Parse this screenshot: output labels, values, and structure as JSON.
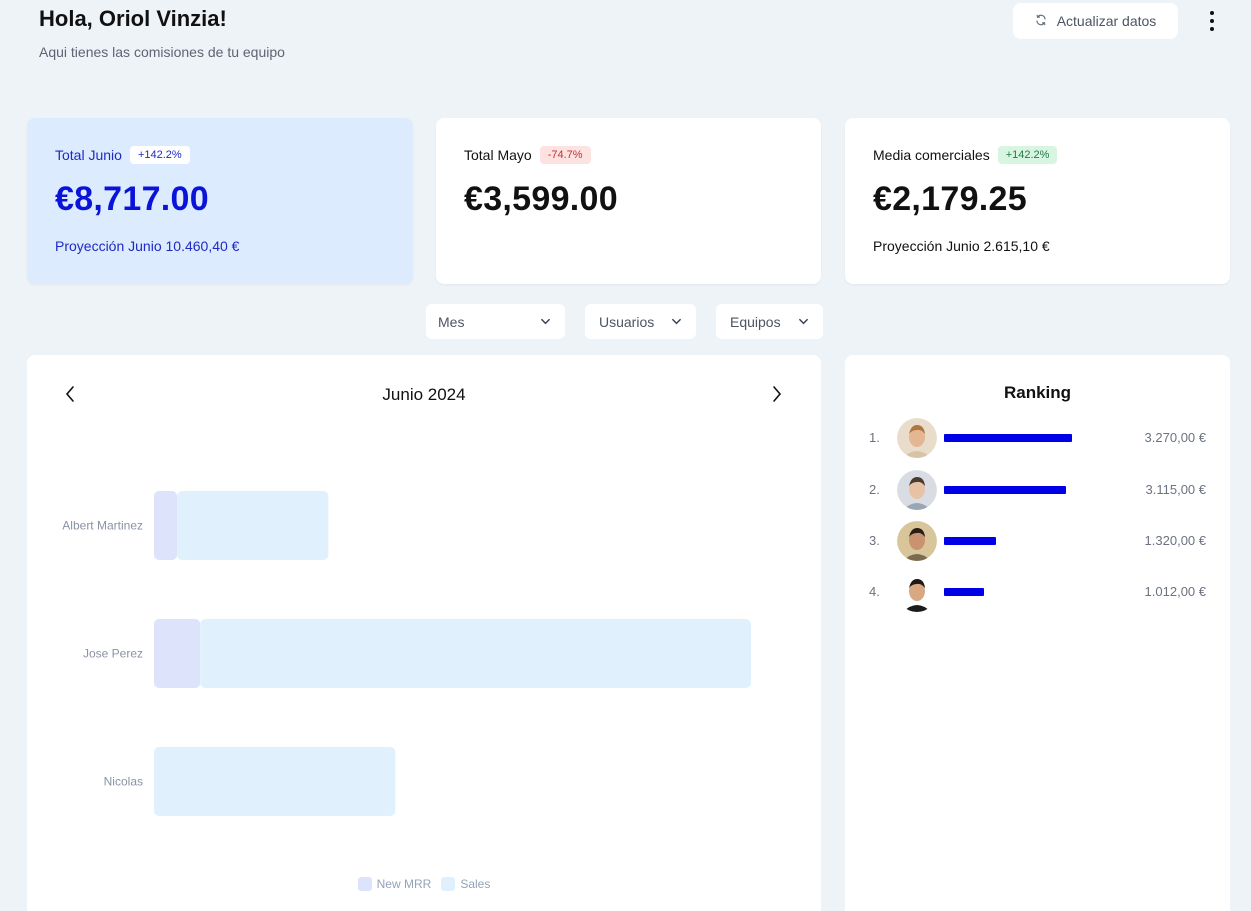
{
  "header": {
    "greeting": "Hola, Oriol Vinzia!",
    "subtitle": "Aqui tienes las comisiones de tu equipo",
    "refresh_label": "Actualizar datos"
  },
  "kpis": [
    {
      "label": "Total Junio",
      "badge": "+142.2%",
      "value": "€8,717.00",
      "projection": "Proyección Junio 10.460,40 €",
      "accent": "#0a14d8"
    },
    {
      "label": "Total Mayo",
      "badge": "-74.7%",
      "value": "€3,599.00",
      "projection": ""
    },
    {
      "label": "Media comerciales",
      "badge": "+142.2%",
      "value": "€2,179.25",
      "projection": "Proyección Junio 2.615,10 €"
    }
  ],
  "filters": {
    "period": "Mes",
    "users": "Usuarios",
    "teams": "Equipos"
  },
  "chart": {
    "month_label": "Junio 2024"
  },
  "chart_data": {
    "type": "bar",
    "orientation": "horizontal",
    "stacked": true,
    "categories": [
      "Albert Martinez",
      "Jose Perez",
      "Nicolas"
    ],
    "series": [
      {
        "name": "New MRR",
        "values": [
          200,
          400,
          0
        ],
        "color": "#dde3fb"
      },
      {
        "name": "Sales",
        "values": [
          1310,
          4770,
          2090
        ],
        "color": "#e0f1fd"
      }
    ],
    "legend": "bottom-center",
    "grid": false
  },
  "ranking": {
    "title": "Ranking",
    "max": 3270,
    "bar_color": "#0000e6",
    "items": [
      {
        "rank": "1.",
        "amount": "3.270,00 €",
        "value": 3270,
        "avatar": "avatar-person-1"
      },
      {
        "rank": "2.",
        "amount": "3.115,00 €",
        "value": 3115,
        "avatar": "avatar-person-2"
      },
      {
        "rank": "3.",
        "amount": "1.320,00 €",
        "value": 1320,
        "avatar": "avatar-person-3"
      },
      {
        "rank": "4.",
        "amount": "1.012,00 €",
        "value": 1012,
        "avatar": "avatar-person-4"
      }
    ]
  }
}
